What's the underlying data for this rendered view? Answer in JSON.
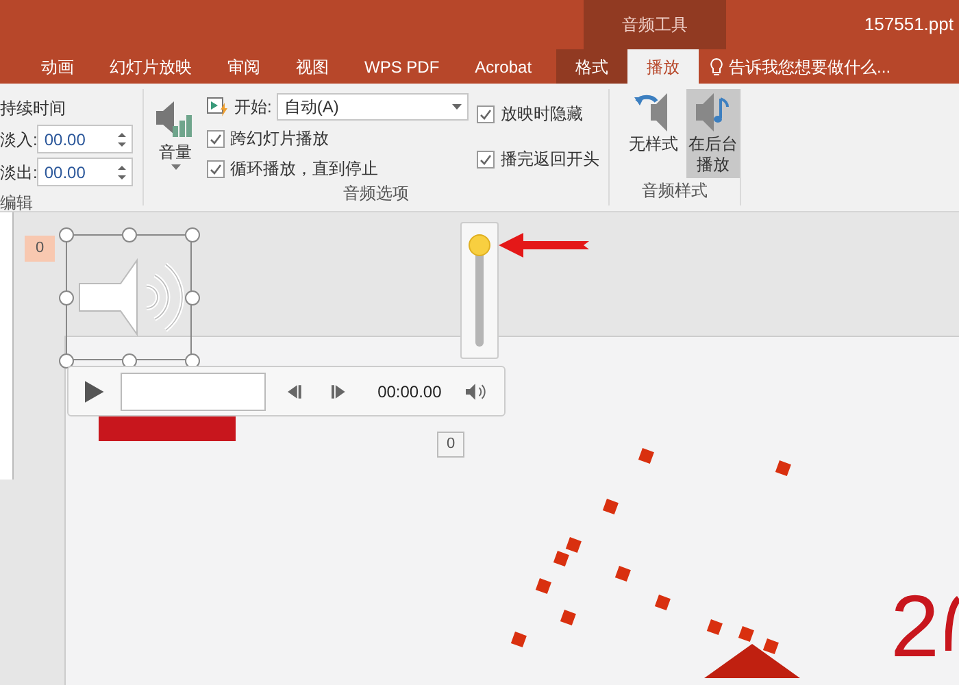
{
  "title_bar": {
    "context_group": "音频工具",
    "file_name": "157551.ppt"
  },
  "tabs": [
    {
      "label": "动画",
      "kind": "normal",
      "selected": false
    },
    {
      "label": "幻灯片放映",
      "kind": "normal",
      "selected": false
    },
    {
      "label": "审阅",
      "kind": "normal",
      "selected": false
    },
    {
      "label": "视图",
      "kind": "normal",
      "selected": false
    },
    {
      "label": "WPS PDF",
      "kind": "normal",
      "selected": false
    },
    {
      "label": "Acrobat",
      "kind": "normal",
      "selected": false
    },
    {
      "label": "格式",
      "kind": "contextual",
      "selected": false
    },
    {
      "label": "播放",
      "kind": "contextual",
      "selected": true
    }
  ],
  "tell_me": "告诉我您想要做什么...",
  "edit_group": {
    "heading": "持续时间",
    "fade_in": {
      "label": "淡入:",
      "value": "00.00"
    },
    "fade_out": {
      "label": "淡出:",
      "value": "00.00"
    },
    "title": "编辑"
  },
  "audio_options": {
    "volume": "音量",
    "start_label": "开始:",
    "start_value": "自动(A)",
    "checks": [
      {
        "label": "跨幻灯片播放",
        "checked": true
      },
      {
        "label": "循环播放，直到停止",
        "checked": true
      },
      {
        "label": "放映时隐藏",
        "checked": true
      },
      {
        "label": "播完返回开头",
        "checked": true
      }
    ],
    "title": "音频选项"
  },
  "audio_styles": {
    "buttons": [
      {
        "label": "无样式",
        "selected": false
      },
      {
        "label": "在后台播放",
        "selected": true
      }
    ],
    "title": "音频样式"
  },
  "canvas": {
    "slide_number": "0",
    "time": "00:00.00",
    "volume": {
      "level": 1
    },
    "tag": "0",
    "slide_text": "2"
  }
}
